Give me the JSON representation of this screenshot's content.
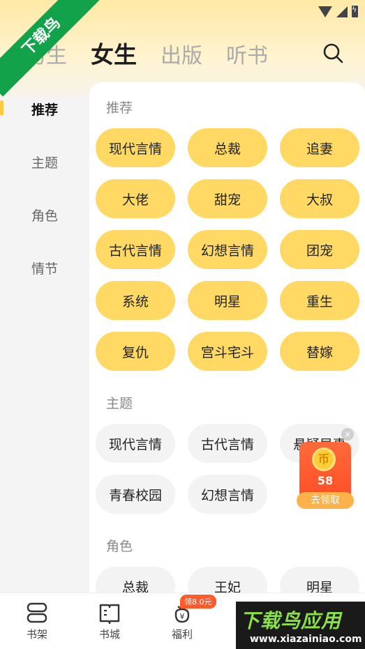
{
  "status_bar": {},
  "corner_banner": "下载鸟",
  "top_tabs": [
    "男生",
    "女生",
    "出版",
    "听书"
  ],
  "sidebar": [
    "推荐",
    "主题",
    "角色",
    "情节"
  ],
  "sections": {
    "recommend": {
      "title": "推荐",
      "tags": [
        "现代言情",
        "总裁",
        "追妻",
        "大佬",
        "甜宠",
        "大叔",
        "古代言情",
        "幻想言情",
        "团宠",
        "系统",
        "明星",
        "重生",
        "复仇",
        "宫斗宅斗",
        "替嫁"
      ]
    },
    "theme": {
      "title": "主题",
      "tags": [
        "现代言情",
        "古代言情",
        "悬疑异事",
        "青春校园",
        "幻想言情"
      ]
    },
    "role": {
      "title": "角色",
      "tags": [
        "总裁",
        "王妃",
        "明星"
      ]
    }
  },
  "floating_reward": {
    "coin_symbol": "币",
    "amount": "58",
    "button": "去领取",
    "close": "×"
  },
  "bottom_nav": {
    "items": [
      "书架",
      "书城",
      "福利"
    ],
    "reward_badge": "领8.0元"
  },
  "watermark": {
    "title": "下载鸟应用",
    "url": "www.xiazainiao.com"
  },
  "colors": {
    "accent_yellow": "#ffd964",
    "active_indicator": "#ffc83d",
    "banner_green": "#12a24a",
    "reward_orange": "#ff5b2d"
  }
}
